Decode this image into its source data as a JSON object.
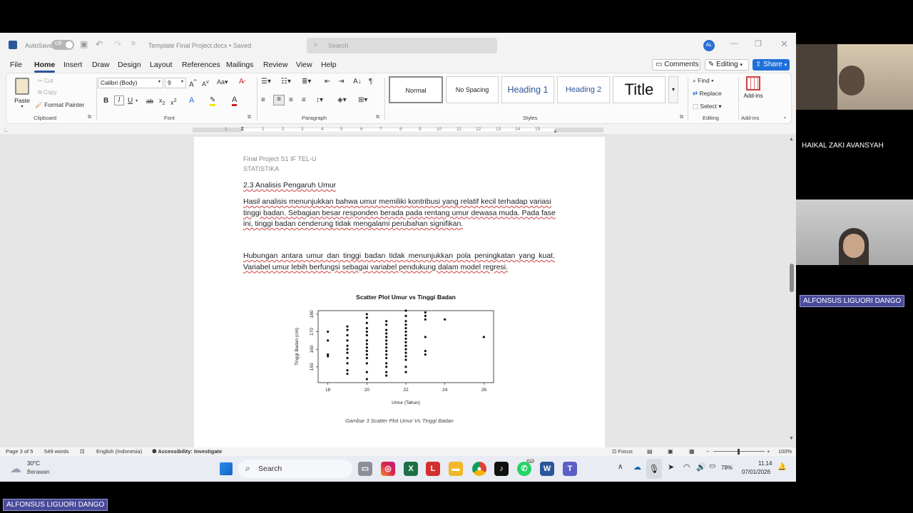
{
  "titlebar": {
    "autosave_label": "AutoSave",
    "autosave_state": "Off",
    "doc_title": "Template Final Project.docx • Saved",
    "search_placeholder": "Search",
    "user_initials": "AL"
  },
  "ribbon_tabs": [
    "File",
    "Home",
    "Insert",
    "Draw",
    "Design",
    "Layout",
    "References",
    "Mailings",
    "Review",
    "View",
    "Help"
  ],
  "top_right": {
    "comments": "Comments",
    "editing": "Editing",
    "share": "Share"
  },
  "clipboard": {
    "paste": "Paste",
    "cut": "Cut",
    "copy": "Copy",
    "format_painter": "Format Painter",
    "label": "Clipboard"
  },
  "font": {
    "name": "Calibri (Body)",
    "size": "9",
    "label": "Font"
  },
  "paragraph": {
    "label": "Paragraph"
  },
  "styles": {
    "items": [
      "Normal",
      "No Spacing",
      "Heading 1",
      "Heading 2",
      "Title"
    ],
    "label": "Styles"
  },
  "editing_group": {
    "find": "Find",
    "replace": "Replace",
    "select": "Select",
    "label": "Editing"
  },
  "addins": {
    "button": "Add-ins",
    "label": "Add-ins"
  },
  "ruler_ticks": [
    "1",
    "1",
    "2",
    "3",
    "4",
    "5",
    "6",
    "7",
    "8",
    "9",
    "10",
    "11",
    "12",
    "13",
    "14",
    "15"
  ],
  "document": {
    "header_line1": "Final Project S1 IF TEL-U",
    "header_line2": "STATISTIKA",
    "heading": "2.3 Analisis Pengaruh Umur",
    "para1": [
      "Hasil analisis menunjukkan bahwa umur memiliki kontribusi yang relatif kecil terhadap variasi",
      "tinggi badan. Sebagian besar responden berada pada rentang umur dewasa muda. Pada fase",
      "ini, tinggi badan cenderung tidak mengalami perubahan signifikan."
    ],
    "para2": [
      "Hubungan antara umur dan tinggi badan tidak menunjukkan pola peningkatan yang kuat.",
      "Variabel umur lebih berfungsi sebagai variabel pendukung dalam model regresi."
    ],
    "caption": "Gambar 3 Scatter Plot Umur Vs Tinggi Badan"
  },
  "chart_data": {
    "type": "scatter",
    "title": "Scatter Plot Umur vs Tinggi Badan",
    "xlabel": "Umur (Tahun)",
    "ylabel": "Tinggi Badan (cm)",
    "xlim": [
      17.5,
      26.5
    ],
    "ylim": [
      141,
      182
    ],
    "x_ticks": [
      18,
      20,
      22,
      24,
      26
    ],
    "y_ticks": [
      150,
      160,
      170,
      180
    ],
    "points": [
      [
        18,
        170
      ],
      [
        18,
        165
      ],
      [
        18,
        157
      ],
      [
        18,
        156
      ],
      [
        19,
        173
      ],
      [
        19,
        171
      ],
      [
        19,
        168
      ],
      [
        19,
        165
      ],
      [
        19,
        162
      ],
      [
        19,
        160
      ],
      [
        19,
        158
      ],
      [
        19,
        155
      ],
      [
        19,
        152
      ],
      [
        19,
        148
      ],
      [
        19,
        146
      ],
      [
        20,
        180
      ],
      [
        20,
        178
      ],
      [
        20,
        175
      ],
      [
        20,
        172
      ],
      [
        20,
        170
      ],
      [
        20,
        168
      ],
      [
        20,
        165
      ],
      [
        20,
        163
      ],
      [
        20,
        161
      ],
      [
        20,
        159
      ],
      [
        20,
        157
      ],
      [
        20,
        155
      ],
      [
        20,
        152
      ],
      [
        20,
        147
      ],
      [
        20,
        143
      ],
      [
        21,
        176
      ],
      [
        21,
        174
      ],
      [
        21,
        171
      ],
      [
        21,
        169
      ],
      [
        21,
        167
      ],
      [
        21,
        165
      ],
      [
        21,
        163
      ],
      [
        21,
        161
      ],
      [
        21,
        159
      ],
      [
        21,
        157
      ],
      [
        21,
        155
      ],
      [
        21,
        152
      ],
      [
        21,
        150
      ],
      [
        21,
        147
      ],
      [
        21,
        145
      ],
      [
        22,
        182
      ],
      [
        22,
        179
      ],
      [
        22,
        176
      ],
      [
        22,
        174
      ],
      [
        22,
        172
      ],
      [
        22,
        170
      ],
      [
        22,
        168
      ],
      [
        22,
        166
      ],
      [
        22,
        164
      ],
      [
        22,
        162
      ],
      [
        22,
        160
      ],
      [
        22,
        158
      ],
      [
        22,
        156
      ],
      [
        22,
        154
      ],
      [
        22,
        150
      ],
      [
        22,
        147
      ],
      [
        23,
        181
      ],
      [
        23,
        179
      ],
      [
        23,
        177
      ],
      [
        23,
        167
      ],
      [
        23,
        159
      ],
      [
        23,
        157
      ],
      [
        24,
        177
      ],
      [
        26,
        167
      ]
    ]
  },
  "statusbar": {
    "page": "Page 3 of 5",
    "words": "549 words",
    "language": "English (Indonesia)",
    "accessibility": "Accessibility: Investigate",
    "focus": "Focus",
    "zoom": "100%"
  },
  "taskbar": {
    "temp": "30°C",
    "weather": "Berawan",
    "search": "Search",
    "battery": "78%",
    "time": "11.14",
    "date": "07/01/2026",
    "whatsapp_badge": "26"
  },
  "participants": [
    {
      "name": "HAIKAL ZAKI AVANSYAH"
    },
    {
      "name": "ALFONSUS LIGUORI DANGO"
    }
  ],
  "presenter_name": "ALFONSUS LIGUORI DANGO"
}
